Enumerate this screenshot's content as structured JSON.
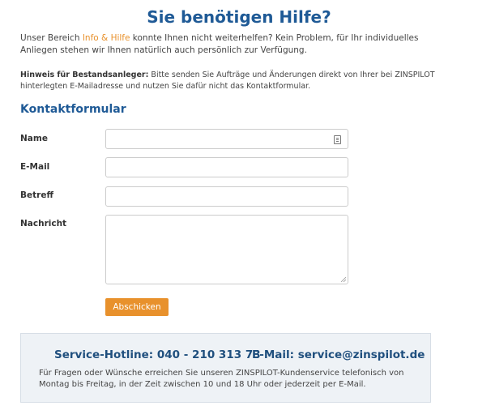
{
  "header": {
    "title": "Sie benötigen Hilfe?"
  },
  "intro": {
    "before": "Unser Bereich ",
    "link": "Info & Hilfe",
    "after": " konnte Ihnen nicht weiterhelfen? Kein Problem, für Ihr individuelles Anliegen stehen wir Ihnen natürlich auch persönlich zur Verfügung."
  },
  "hint": {
    "label": "Hinweis für Bestandsanleger:",
    "text": " Bitte senden Sie Aufträge und Änderungen direkt von Ihrer bei ZINSPILOT hinterlegten E-Mailadresse und nutzen Sie dafür nicht das Kontaktformular."
  },
  "form": {
    "heading": "Kontaktformular",
    "fields": {
      "name": {
        "label": "Name",
        "value": ""
      },
      "email": {
        "label": "E-Mail",
        "value": ""
      },
      "subject": {
        "label": "Betreff",
        "value": ""
      },
      "message": {
        "label": "Nachricht",
        "value": ""
      }
    },
    "submit_label": "Abschicken"
  },
  "service": {
    "hotline": "Service-Hotline: 040 - 210 313 73",
    "email": "E-Mail: service@zinspilot.de",
    "text": "Für Fragen oder Wünsche erreichen Sie unseren ZINSPILOT-Kundenservice telefonisch von Montag bis Freitag, in der Zeit zwischen 10 und 18 Uhr oder jederzeit per E-Mail."
  },
  "colors": {
    "primary": "#1f5a96",
    "accent": "#e8912c",
    "box_background": "#eef2f6"
  }
}
